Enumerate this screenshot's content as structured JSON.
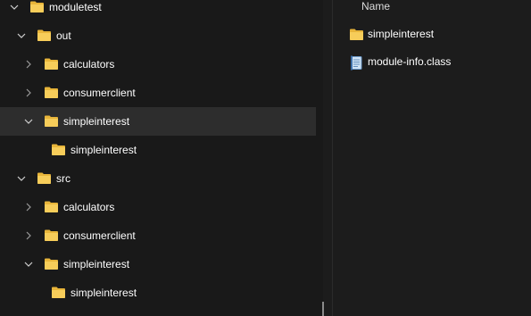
{
  "tree": {
    "items": [
      {
        "label": "moduletest",
        "expanded": true
      },
      {
        "label": "out",
        "expanded": true
      },
      {
        "label": "calculators",
        "expanded": false
      },
      {
        "label": "consumerclient",
        "expanded": false
      },
      {
        "label": "simpleinterest",
        "expanded": true,
        "selected": true
      },
      {
        "label": "simpleinterest"
      },
      {
        "label": "src",
        "expanded": true
      },
      {
        "label": "calculators",
        "expanded": false
      },
      {
        "label": "consumerclient",
        "expanded": false
      },
      {
        "label": "simpleinterest",
        "expanded": true
      },
      {
        "label": "simpleinterest"
      }
    ]
  },
  "content": {
    "column_header": "Name",
    "files": [
      {
        "name": "simpleinterest",
        "icon": "folder-icon"
      },
      {
        "name": "module-info.class",
        "icon": "document-icon"
      }
    ]
  },
  "colors": {
    "folder": "#f5c542",
    "selected_row": "#2d2d2d",
    "background": "#1c1c1c"
  }
}
